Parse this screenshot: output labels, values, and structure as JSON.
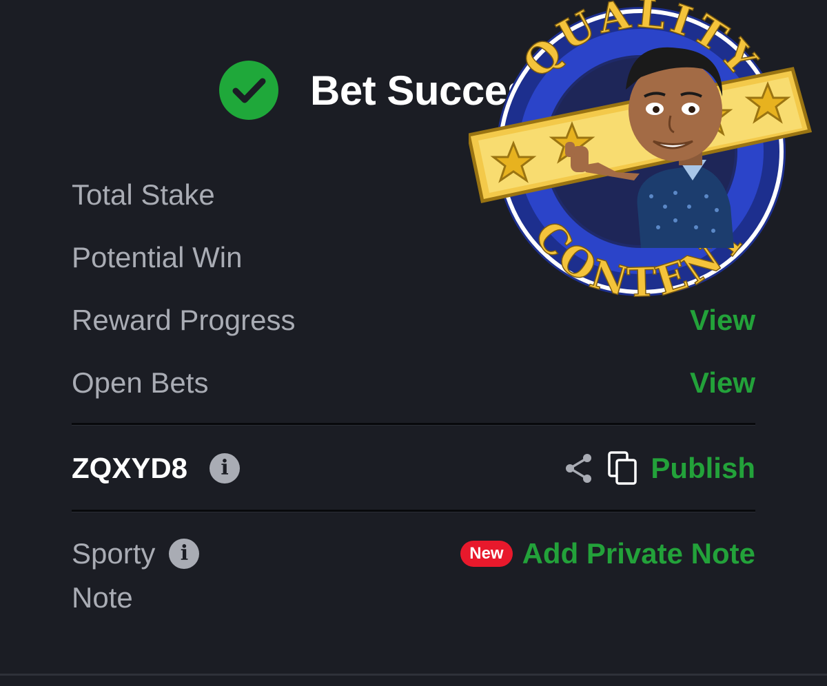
{
  "header": {
    "title": "Bet Successful",
    "status_icon": "check-circle-icon",
    "accent_color": "#1fa83a"
  },
  "summary": {
    "rows": [
      {
        "label": "Total Stake",
        "value": ""
      },
      {
        "label": "Potential Win",
        "value": ""
      },
      {
        "label": "Reward Progress",
        "action": "View"
      },
      {
        "label": "Open Bets",
        "action": "View"
      }
    ]
  },
  "booking": {
    "code": "ZQXYD8",
    "info_icon": "info-icon",
    "share_icon": "share-icon",
    "copy_icon": "copy-icon",
    "publish_label": "Publish"
  },
  "note": {
    "label": "Sporty Note",
    "label_line1": "Sporty",
    "label_line2": "Note",
    "badge": "New",
    "action": "Add Private Note"
  },
  "sticker": {
    "top_text": "QUALITY",
    "bottom_text": "CONTENT"
  },
  "colors": {
    "background": "#1b1d24",
    "label_gray": "#a9acb4",
    "link_green": "#23a23a",
    "badge_red": "#e8192c"
  }
}
